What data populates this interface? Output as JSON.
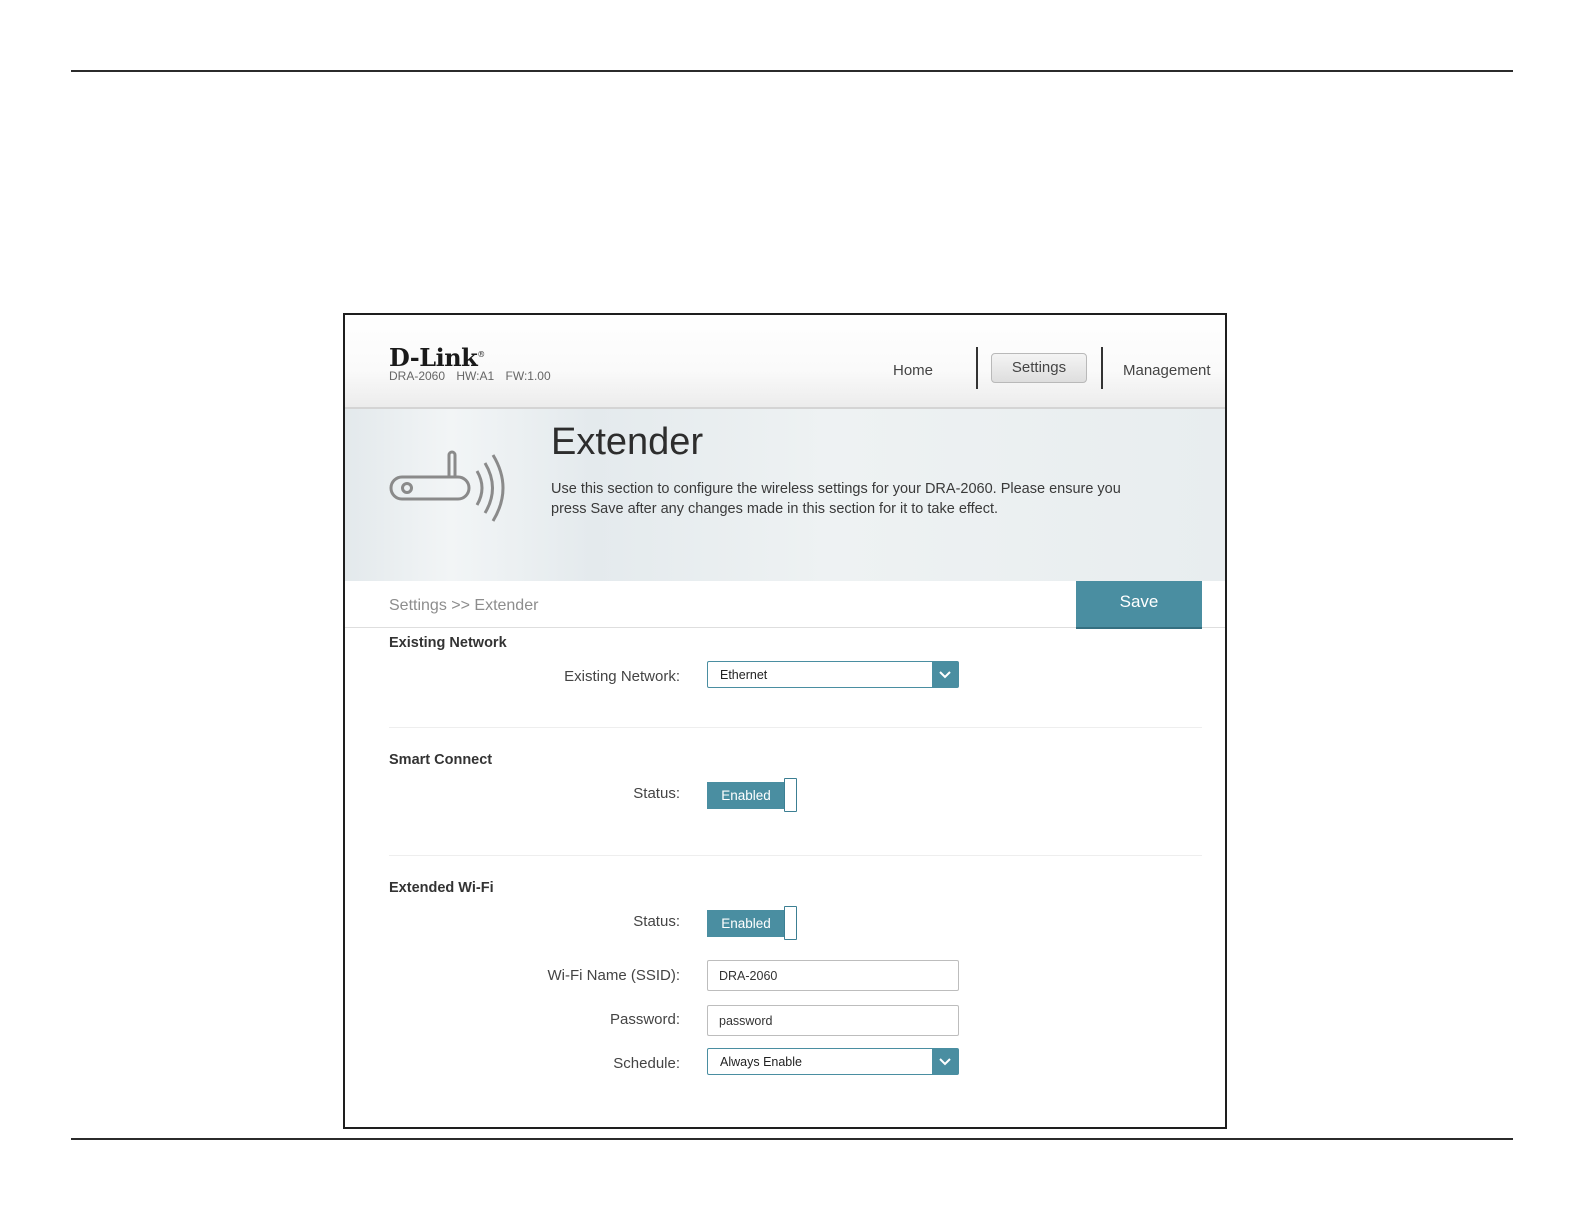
{
  "header": {
    "logo": "D-Link",
    "model": "DRA-2060",
    "hw": "HW:A1",
    "fw": "FW:1.00",
    "nav": {
      "home": "Home",
      "settings": "Settings",
      "management": "Management"
    }
  },
  "banner": {
    "title": "Extender",
    "description": "Use this section to configure the wireless settings for your DRA-2060. Please ensure you press Save after any changes made in this section for it to take effect."
  },
  "breadcrumb": "Settings >> Extender",
  "save_label": "Save",
  "sections": {
    "existing_network": {
      "title": "Existing Network",
      "label": "Existing Network:",
      "value": "Ethernet"
    },
    "smart_connect": {
      "title": "Smart Connect",
      "status_label": "Status:",
      "status_value": "Enabled"
    },
    "extended_wifi": {
      "title": "Extended Wi-Fi",
      "status_label": "Status:",
      "status_value": "Enabled",
      "ssid_label": "Wi-Fi Name (SSID):",
      "ssid_value": "DRA-2060",
      "password_label": "Password:",
      "password_value": "password",
      "schedule_label": "Schedule:",
      "schedule_value": "Always Enable"
    }
  },
  "colors": {
    "accent": "#4a8ea1"
  }
}
